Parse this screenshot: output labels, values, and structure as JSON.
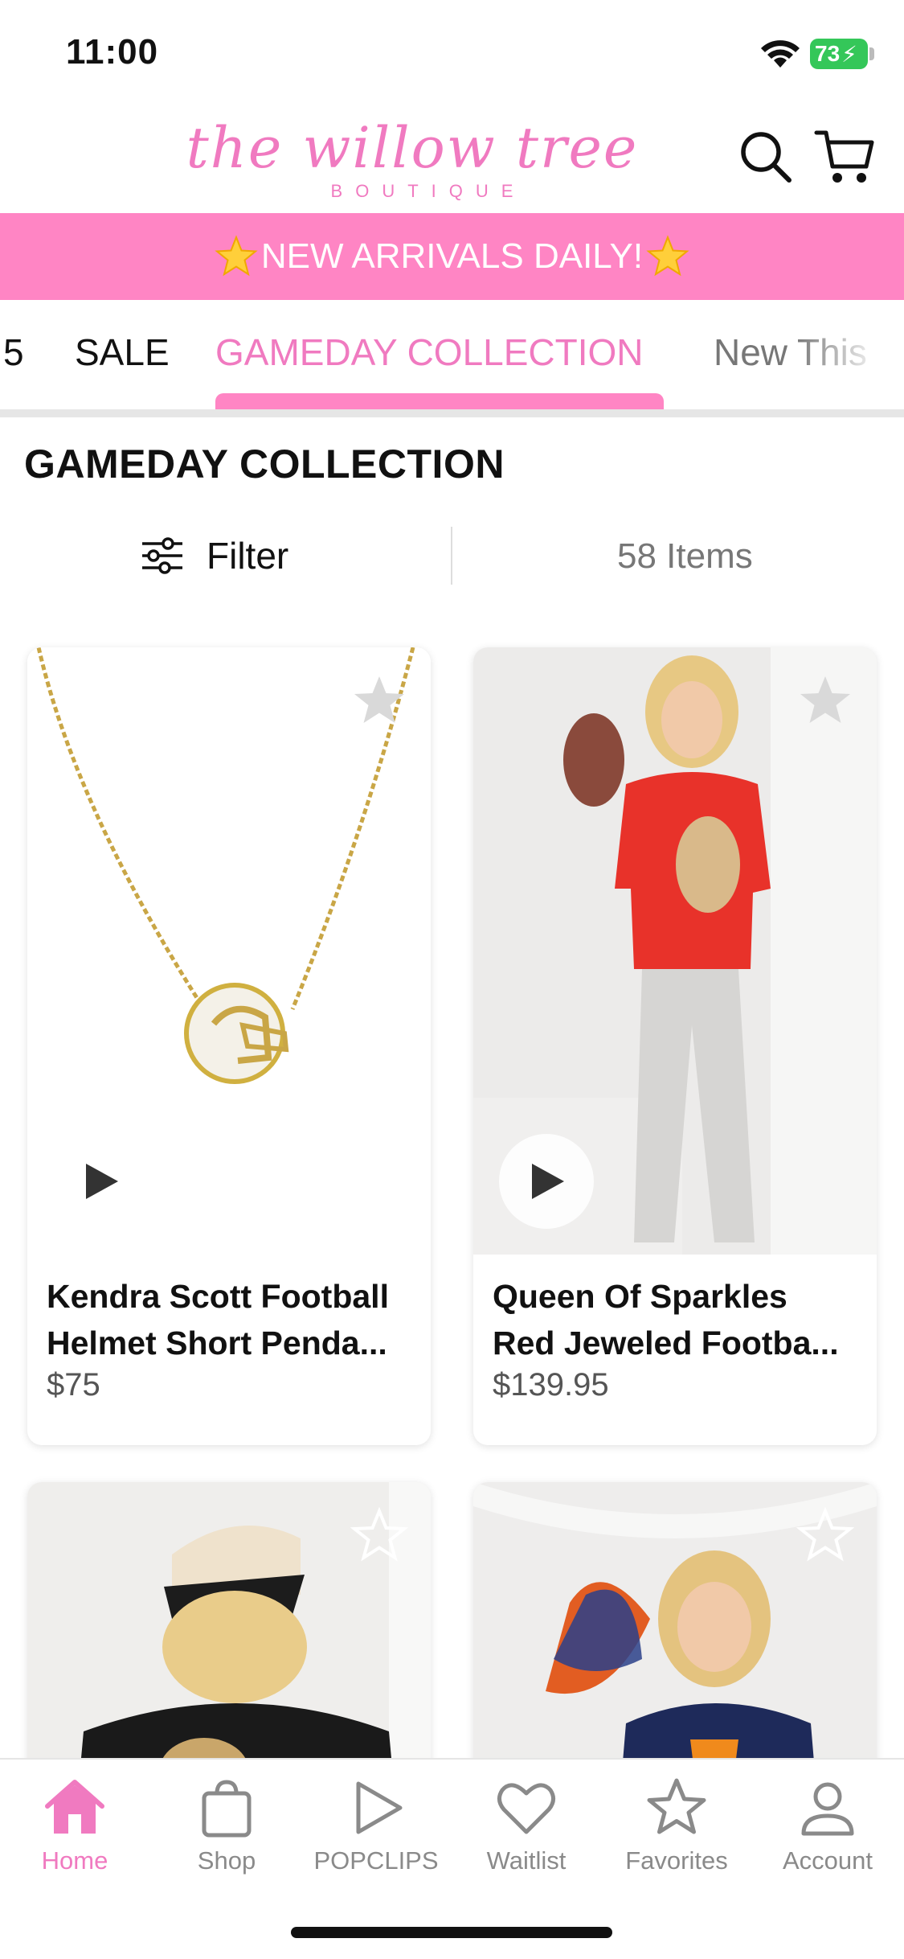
{
  "status_bar": {
    "time": "11:00",
    "battery": "73"
  },
  "header": {
    "logo_script": "the willow tree",
    "logo_sub": "BOUTIQUE",
    "icons": [
      "search-icon",
      "cart-icon"
    ]
  },
  "promo": {
    "text": "NEW ARRIVALS DAILY!",
    "icon": "star-emoji"
  },
  "tabs": {
    "items": [
      "5",
      "SALE",
      "GAMEDAY COLLECTION",
      "New This"
    ],
    "active": "GAMEDAY COLLECTION"
  },
  "section": {
    "title": "GAMEDAY COLLECTION",
    "filter_label": "Filter",
    "item_count": "58 Items"
  },
  "products": [
    {
      "title_line1": "Kendra Scott Football",
      "title_line2": "Helmet Short Penda...",
      "price": "$75"
    },
    {
      "title_line1": "Queen Of Sparkles",
      "title_line2": "Red Jeweled Footba...",
      "price": "$139.95"
    },
    {
      "title_line1": "",
      "title_line2": "",
      "price": ""
    },
    {
      "title_line1": "",
      "title_line2": "",
      "price": ""
    }
  ],
  "bottom_nav": [
    {
      "label": "Home",
      "icon": "home-icon",
      "active": true
    },
    {
      "label": "Shop",
      "icon": "bag-icon",
      "active": false
    },
    {
      "label": "POPCLIPS",
      "icon": "play-icon",
      "active": false
    },
    {
      "label": "Waitlist",
      "icon": "heart-icon",
      "active": false
    },
    {
      "label": "Favorites",
      "icon": "star-icon",
      "active": false
    },
    {
      "label": "Account",
      "icon": "person-icon",
      "active": false
    }
  ],
  "colors": {
    "brand_pink": "#ff85c4",
    "accent_pink": "#f07ac0",
    "nav_gray": "#8a8a8a",
    "battery_green": "#34c759"
  }
}
